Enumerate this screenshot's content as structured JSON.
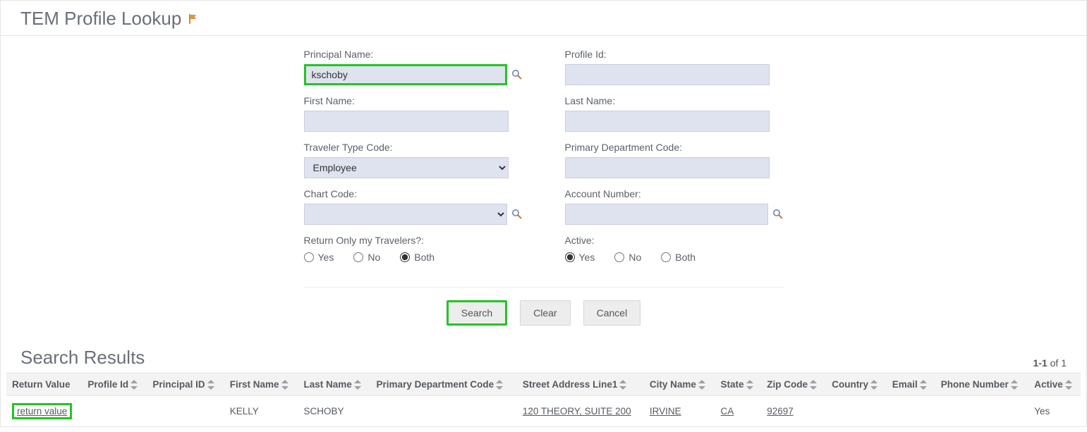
{
  "page": {
    "title": "TEM Profile Lookup"
  },
  "form": {
    "principal_name": {
      "label": "Principal Name:",
      "value": "kschoby"
    },
    "profile_id": {
      "label": "Profile Id:",
      "value": ""
    },
    "first_name": {
      "label": "First Name:",
      "value": ""
    },
    "last_name": {
      "label": "Last Name:",
      "value": ""
    },
    "traveler_type": {
      "label": "Traveler Type Code:",
      "selected": "Employee"
    },
    "primary_dept": {
      "label": "Primary Department Code:",
      "value": ""
    },
    "chart_code": {
      "label": "Chart Code:",
      "selected": ""
    },
    "account_number": {
      "label": "Account Number:",
      "value": ""
    },
    "return_only": {
      "label": "Return Only my Travelers?:",
      "options": {
        "yes": "Yes",
        "no": "No",
        "both": "Both"
      },
      "selected": "both"
    },
    "active": {
      "label": "Active:",
      "options": {
        "yes": "Yes",
        "no": "No",
        "both": "Both"
      },
      "selected": "yes"
    }
  },
  "actions": {
    "search": "Search",
    "clear": "Clear",
    "cancel": "Cancel"
  },
  "results": {
    "title": "Search Results",
    "range": "1-1",
    "of_label": "of",
    "total": "1",
    "columns": {
      "return_value": "Return Value",
      "profile_id": "Profile Id",
      "principal_id": "Principal ID",
      "first_name": "First Name",
      "last_name": "Last Name",
      "primary_dept": "Primary Department Code",
      "street1": "Street Address Line1",
      "city": "City Name",
      "state": "State",
      "zip": "Zip Code",
      "country": "Country",
      "email": "Email",
      "phone": "Phone Number",
      "active": "Active"
    },
    "rows": [
      {
        "return_value": "return value",
        "profile_id": "",
        "principal_id": "",
        "first_name": "KELLY",
        "last_name": "SCHOBY",
        "primary_dept": "",
        "street1": "120 THEORY, SUITE 200",
        "city": "IRVINE",
        "state": "CA",
        "zip": "92697",
        "country": "",
        "email": "",
        "phone": "",
        "active": "Yes"
      }
    ]
  }
}
